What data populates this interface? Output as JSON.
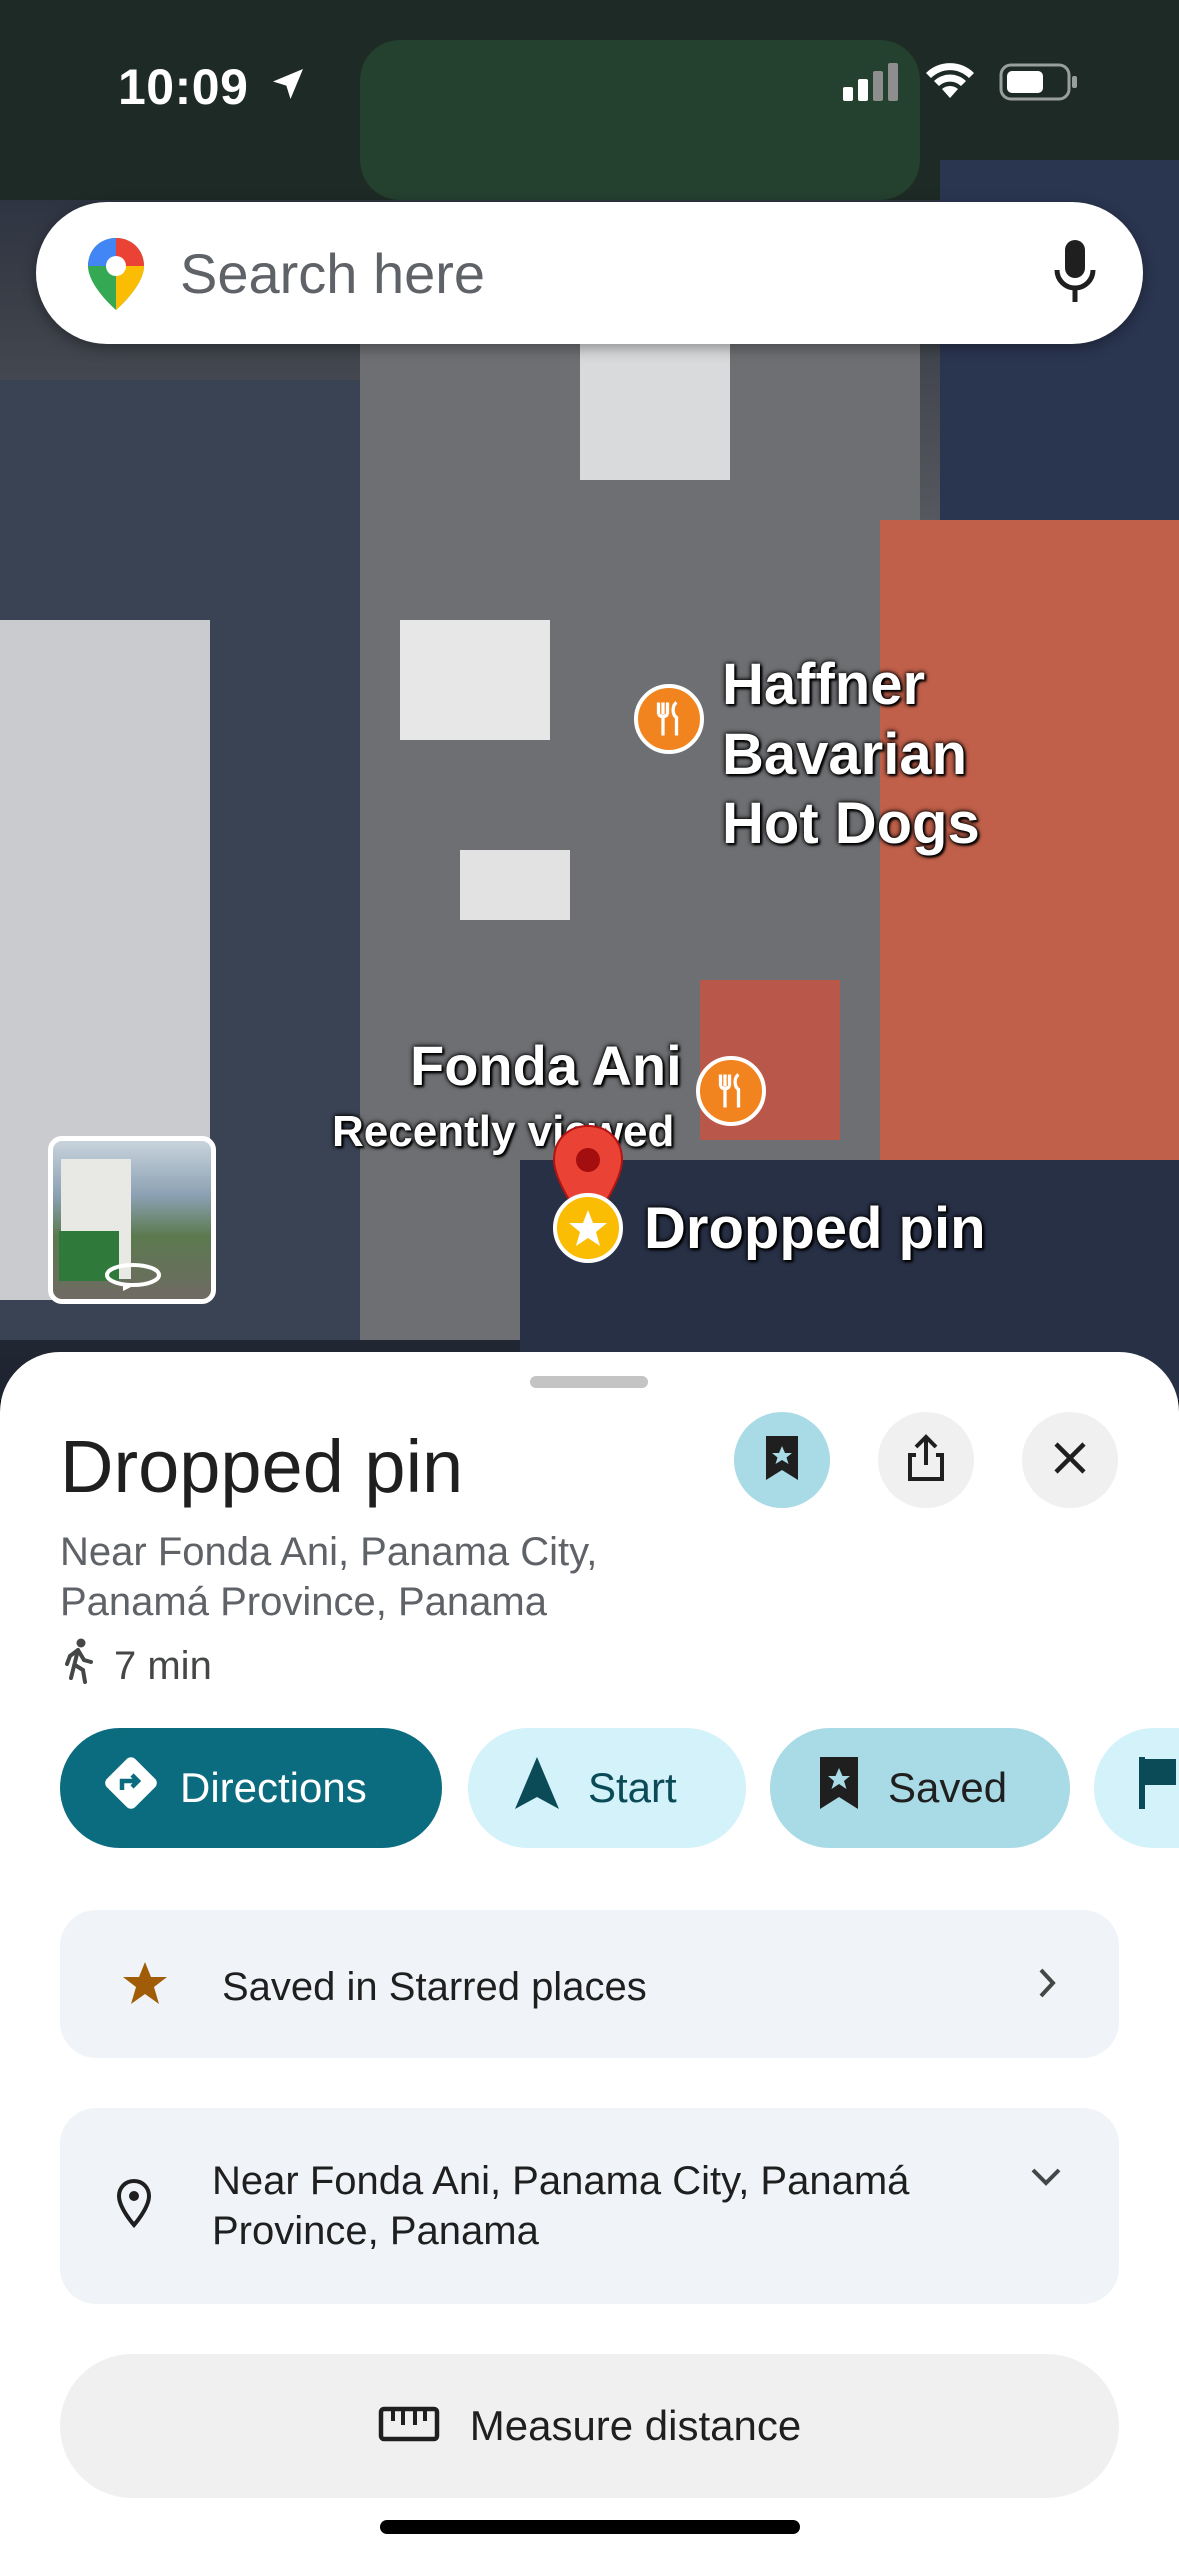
{
  "status_bar": {
    "time": "10:09"
  },
  "search": {
    "placeholder": "Search here"
  },
  "map": {
    "places": [
      {
        "name_line1": "Haffner Bavarian",
        "name_line2": "Hot Dogs"
      },
      {
        "name": "Fonda Ani",
        "note": "Recently viewed"
      }
    ],
    "dropped_pin_label": "Dropped pin"
  },
  "sheet": {
    "title": "Dropped pin",
    "address_line1": "Near Fonda Ani, Panama City,",
    "address_line2": "Panamá Province, Panama",
    "walk_time": "7 min",
    "actions": {
      "directions": "Directions",
      "start": "Start",
      "saved": "Saved"
    },
    "saved_list_text": "Saved in Starred places",
    "address_card_line1": "Near Fonda Ani, Panama City, Panamá",
    "address_card_line2": "Province, Panama",
    "measure_distance": "Measure distance"
  },
  "colors": {
    "accent_teal": "#0b6c7f",
    "chip_light": "#d3f2fa",
    "chip_saved": "#a8dbe5",
    "pin_red": "#ea4335",
    "poi_orange": "#f2841f",
    "star_brown": "#a15c07"
  },
  "icons": {
    "status": [
      "location-arrow-icon",
      "signal-icon",
      "wifi-icon",
      "battery-icon"
    ],
    "search": [
      "google-maps-pin-icon",
      "mic-icon"
    ],
    "sheet": [
      "bookmark-icon",
      "share-icon",
      "close-icon",
      "walk-icon",
      "directions-icon",
      "navigation-arrow-icon",
      "star-icon",
      "chevron-right-icon",
      "location-pin-icon",
      "chevron-down-icon",
      "ruler-icon"
    ]
  }
}
